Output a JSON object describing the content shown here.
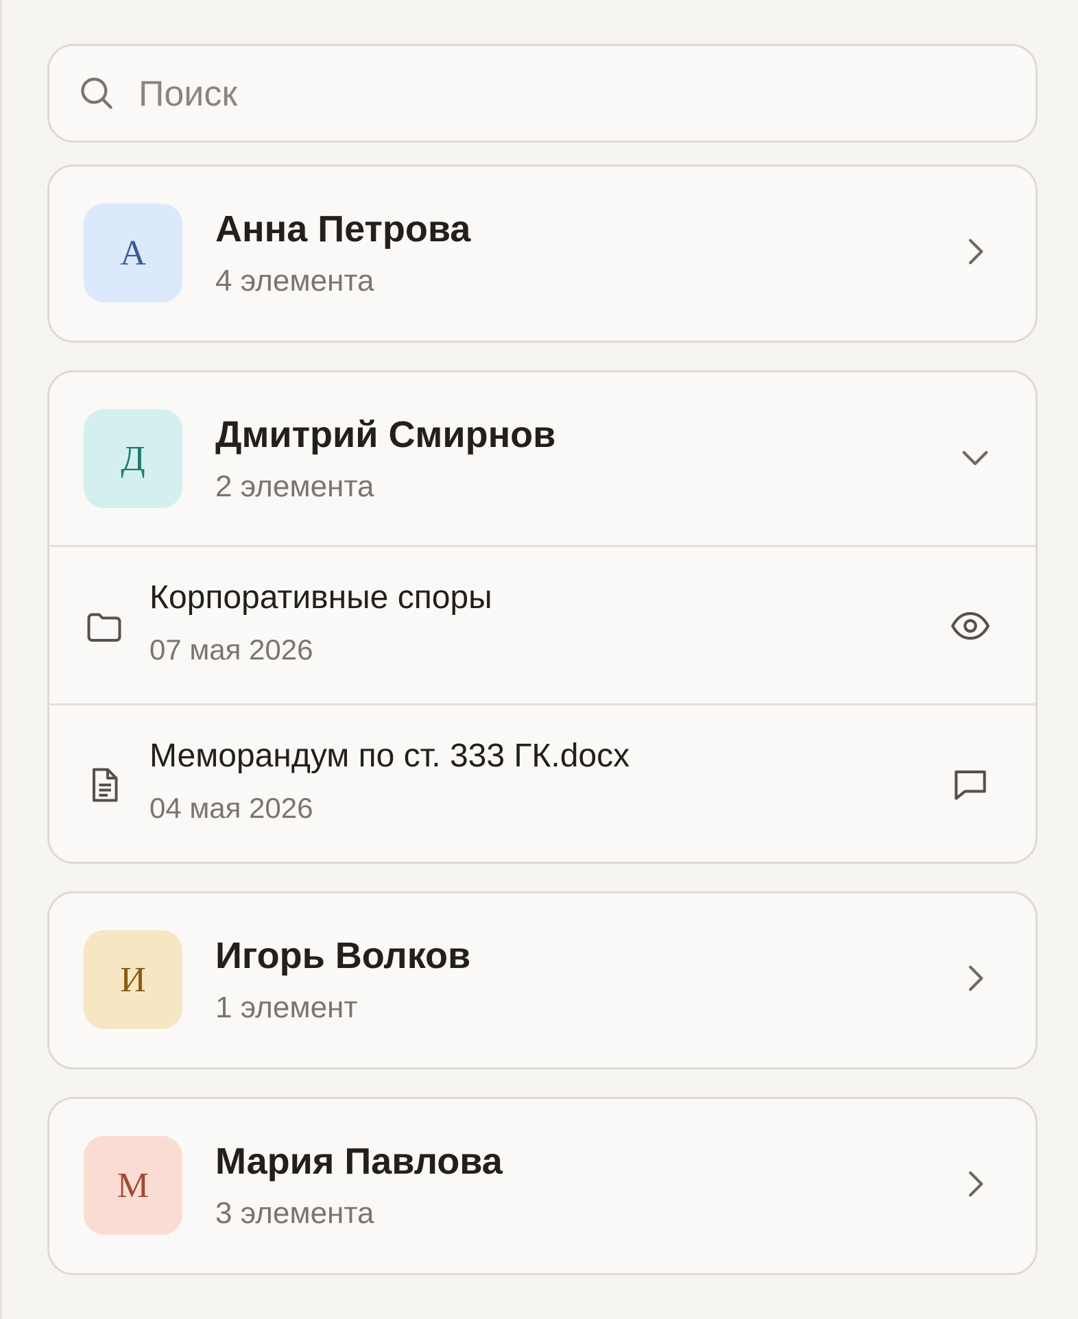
{
  "search": {
    "placeholder": "Поиск",
    "value": ""
  },
  "clients": [
    {
      "initial": "А",
      "name": "Анна Петрова",
      "count": "4 элемента",
      "avatar_bg": "#dce8fb",
      "avatar_fg": "#3a5a98",
      "expanded": false
    },
    {
      "initial": "Д",
      "name": "Дмитрий Смирнов",
      "count": "2 элемента",
      "avatar_bg": "#d3f0ee",
      "avatar_fg": "#1f7a72",
      "expanded": true,
      "items": [
        {
          "icon": "folder-icon",
          "title": "Корпоративные споры",
          "date": "07 мая 2026",
          "action": "eye-icon"
        },
        {
          "icon": "document-icon",
          "title": "Меморандум по ст. 333 ГК.docx",
          "date": "04 мая 2026",
          "action": "comment-icon"
        }
      ]
    },
    {
      "initial": "И",
      "name": "Игорь Волков",
      "count": "1 элемент",
      "avatar_bg": "#f7e6c4",
      "avatar_fg": "#8a5a10",
      "expanded": false
    },
    {
      "initial": "М",
      "name": "Мария Павлова",
      "count": "3 элемента",
      "avatar_bg": "#fbdcd2",
      "avatar_fg": "#a04a36",
      "expanded": false
    }
  ],
  "colors": {
    "accent_border": "#dedad4",
    "background": "#f7f5f2",
    "muted_text": "#7a756e"
  }
}
